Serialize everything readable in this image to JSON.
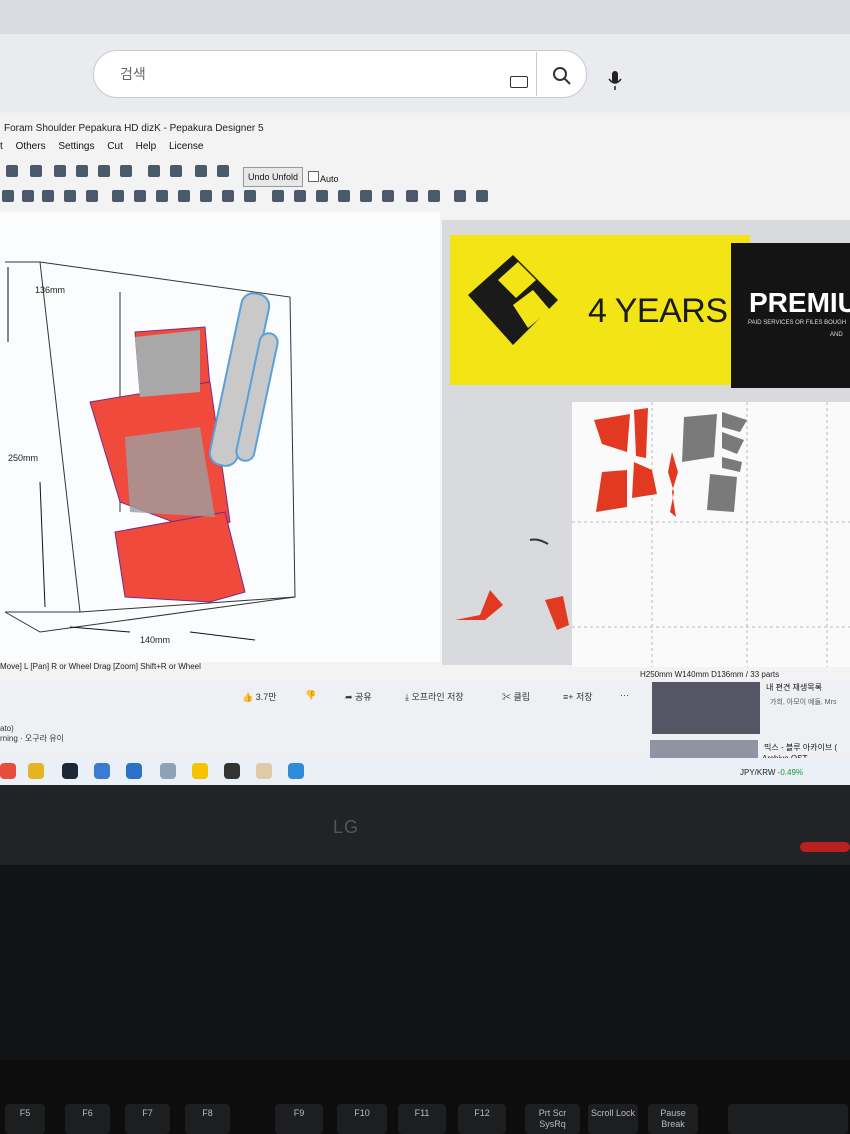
{
  "browser": {
    "search_placeholder": "검색"
  },
  "pepakura": {
    "title": "Foram Shoulder Pepakura HD dizK - Pepakura Designer 5",
    "menu": [
      "t",
      "Others",
      "Settings",
      "Cut",
      "Help",
      "License"
    ],
    "undo_unfold": "Undo Unfold",
    "auto_label": "Auto",
    "dim_depth": "136mm",
    "dim_height": "250mm",
    "dim_width": "140mm",
    "status_left": "Move] L [Pan] R or Wheel Drag [Zoom] Shift+R or Wheel",
    "status_right": "H250mm W140mm D136mm / 33 parts"
  },
  "banner": {
    "years": "4 YEARS",
    "premium": "PREMIU",
    "sub": "PAID SERVICES OR FILES BOUGH",
    "sub2": "AND"
  },
  "actions": {
    "likes": "3.7만",
    "share": "공유",
    "offline": "오프라인 저장",
    "clip": "클립",
    "save": "저장",
    "more": "···"
  },
  "side": {
    "v1_title": "내 편견 재생목록",
    "v1_sub": "가희, 아모이 예들, Mrs",
    "v2_title": "믹스 - 블루 아카이브 (",
    "v2_sub": "Archive OST"
  },
  "lower_left": {
    "line1": "ato)",
    "line2": "rning · 오구라 유이"
  },
  "taskbar": {
    "ticker_pair": "JPY/KRW",
    "ticker_change": "-0.49%"
  },
  "monitor": {
    "brand": "LG"
  },
  "keys": [
    "F5",
    "F6",
    "F7",
    "F8",
    "F9",
    "F10",
    "F11",
    "F12",
    "Prt Scr SysRq",
    "Scroll Lock",
    "Pause Break"
  ],
  "colors": {
    "part_red": "#f04a3c",
    "part_gray": "#a9a9a9",
    "banner_yellow": "#f3e515"
  }
}
